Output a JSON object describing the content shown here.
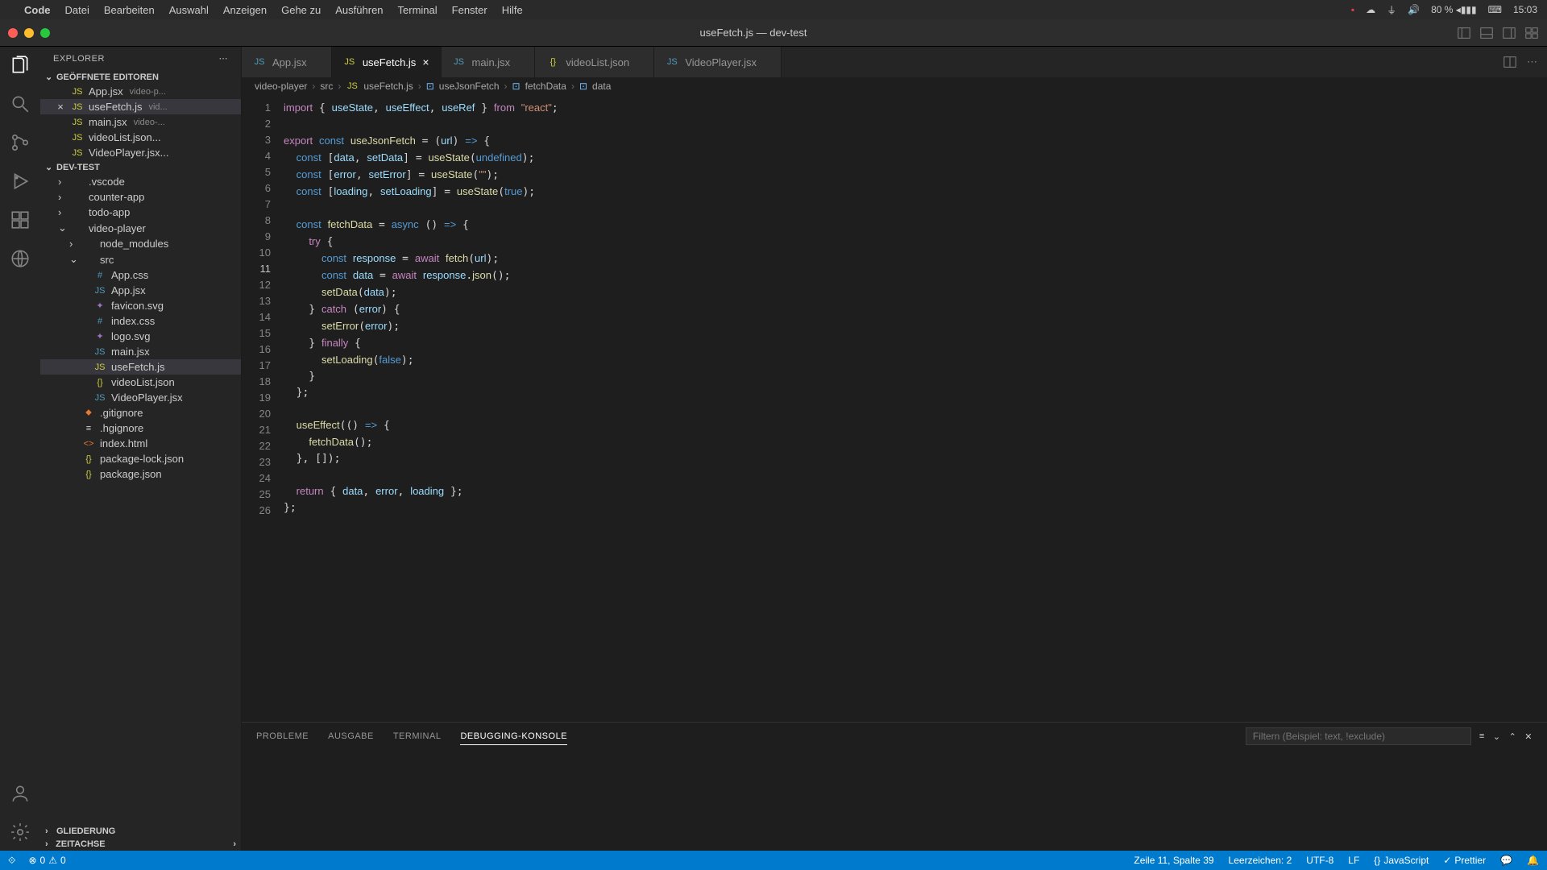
{
  "menubar": {
    "app": "Code",
    "items": [
      "Datei",
      "Bearbeiten",
      "Auswahl",
      "Anzeigen",
      "Gehe zu",
      "Ausführen",
      "Terminal",
      "Fenster",
      "Hilfe"
    ],
    "battery": "80 %",
    "time": "15:03"
  },
  "window": {
    "title": "useFetch.js — dev-test"
  },
  "sidebar": {
    "title": "EXPLORER",
    "open_editors_label": "GEÖFFNETE EDITOREN",
    "open_editors": [
      {
        "name": "App.jsx",
        "hint": "video-p..."
      },
      {
        "name": "useFetch.js",
        "hint": "vid...",
        "active": true,
        "close": true
      },
      {
        "name": "main.jsx",
        "hint": "video-..."
      },
      {
        "name": "videoList.json...",
        "hint": ""
      },
      {
        "name": "VideoPlayer.jsx...",
        "hint": ""
      }
    ],
    "workspace_label": "DEV-TEST",
    "tree": [
      {
        "depth": 1,
        "chev": "›",
        "icon": "",
        "name": ".vscode"
      },
      {
        "depth": 1,
        "chev": "›",
        "icon": "",
        "name": "counter-app"
      },
      {
        "depth": 1,
        "chev": "›",
        "icon": "",
        "name": "todo-app"
      },
      {
        "depth": 1,
        "chev": "⌄",
        "icon": "",
        "name": "video-player"
      },
      {
        "depth": 2,
        "chev": "›",
        "icon": "",
        "name": "node_modules"
      },
      {
        "depth": 2,
        "chev": "⌄",
        "icon": "",
        "name": "src"
      },
      {
        "depth": 3,
        "chev": "",
        "icon": "#",
        "cls": "css",
        "name": "App.css"
      },
      {
        "depth": 3,
        "chev": "",
        "icon": "JS",
        "cls": "jsx",
        "name": "App.jsx"
      },
      {
        "depth": 3,
        "chev": "",
        "icon": "✦",
        "cls": "svg",
        "name": "favicon.svg"
      },
      {
        "depth": 3,
        "chev": "",
        "icon": "#",
        "cls": "css",
        "name": "index.css"
      },
      {
        "depth": 3,
        "chev": "",
        "icon": "✦",
        "cls": "svg",
        "name": "logo.svg"
      },
      {
        "depth": 3,
        "chev": "",
        "icon": "JS",
        "cls": "jsx",
        "name": "main.jsx"
      },
      {
        "depth": 3,
        "chev": "",
        "icon": "JS",
        "cls": "js",
        "name": "useFetch.js",
        "active": true
      },
      {
        "depth": 3,
        "chev": "",
        "icon": "{}",
        "cls": "json",
        "name": "videoList.json"
      },
      {
        "depth": 3,
        "chev": "",
        "icon": "JS",
        "cls": "jsx",
        "name": "VideoPlayer.jsx"
      },
      {
        "depth": 2,
        "chev": "",
        "icon": "⬥",
        "cls": "git",
        "name": ".gitignore"
      },
      {
        "depth": 2,
        "chev": "",
        "icon": "≡",
        "cls": "",
        "name": ".hgignore"
      },
      {
        "depth": 2,
        "chev": "",
        "icon": "<>",
        "cls": "html",
        "name": "index.html"
      },
      {
        "depth": 2,
        "chev": "",
        "icon": "{}",
        "cls": "json",
        "name": "package-lock.json"
      },
      {
        "depth": 2,
        "chev": "",
        "icon": "{}",
        "cls": "json",
        "name": "package.json"
      }
    ],
    "outline_label": "GLIEDERUNG",
    "timeline_label": "ZEITACHSE"
  },
  "tabs": [
    {
      "icon": "JS",
      "cls": "jsx",
      "name": "App.jsx"
    },
    {
      "icon": "JS",
      "cls": "js",
      "name": "useFetch.js",
      "active": true
    },
    {
      "icon": "JS",
      "cls": "jsx",
      "name": "main.jsx"
    },
    {
      "icon": "{}",
      "cls": "json",
      "name": "videoList.json"
    },
    {
      "icon": "JS",
      "cls": "jsx",
      "name": "VideoPlayer.jsx"
    }
  ],
  "breadcrumbs": [
    "video-player",
    "src",
    "useFetch.js",
    "useJsonFetch",
    "fetchData",
    "data"
  ],
  "code": {
    "lines": 26,
    "current_line": 11
  },
  "panel": {
    "tabs": [
      "PROBLEME",
      "AUSGABE",
      "TERMINAL",
      "DEBUGGING-KONSOLE"
    ],
    "active": 3,
    "filter_placeholder": "Filtern (Beispiel: text, !exclude)"
  },
  "statusbar": {
    "errors": "0",
    "warnings": "0",
    "cursor": "Zeile 11, Spalte 39",
    "spaces": "Leerzeichen: 2",
    "encoding": "UTF-8",
    "eol": "LF",
    "language": "JavaScript",
    "formatter": "Prettier"
  }
}
